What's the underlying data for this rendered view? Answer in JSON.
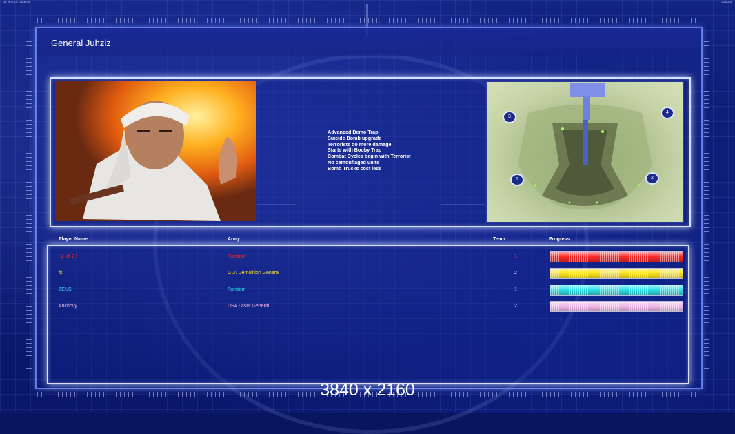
{
  "status": {
    "left": "GE 20.6.0.0 | 20:36:34",
    "right": "00:00:00"
  },
  "general": {
    "title": "General Juhziz",
    "traits": [
      "Advanced Demo Trap",
      "Suicide Bomb upgrade",
      "Terrorists do more damage",
      "Starts with Booby Trap",
      "Combat Cycles begin with Terrorist",
      "No camouflaged units",
      "Bomb Trucks cost less"
    ]
  },
  "map": {
    "start_positions": [
      "1",
      "2",
      "3",
      "4"
    ]
  },
  "table": {
    "headers": {
      "player": "Player Name",
      "army": "Army",
      "team": "Team",
      "progress": "Progress"
    },
    "rows": [
      {
        "player": "! 2 v6 2 !",
        "army": "Random",
        "team": "1",
        "color": "#ff2a2a",
        "progress": 1.0
      },
      {
        "player": "fk",
        "army": "GLA Demolition General",
        "team": "2",
        "color": "#ffe61e",
        "progress": 1.0
      },
      {
        "player": "ZEUS",
        "army": "Random",
        "team": "1",
        "color": "#33e0e8",
        "progress": 1.0
      },
      {
        "player": "Anchovy",
        "army": "USA Laser General",
        "team": "2",
        "color": "#f0b8e8",
        "progress": 1.0
      }
    ]
  },
  "resolution_label": "3840 x 2160",
  "colors": {
    "frame": "#d8e0ff",
    "background": "#0a1560"
  }
}
